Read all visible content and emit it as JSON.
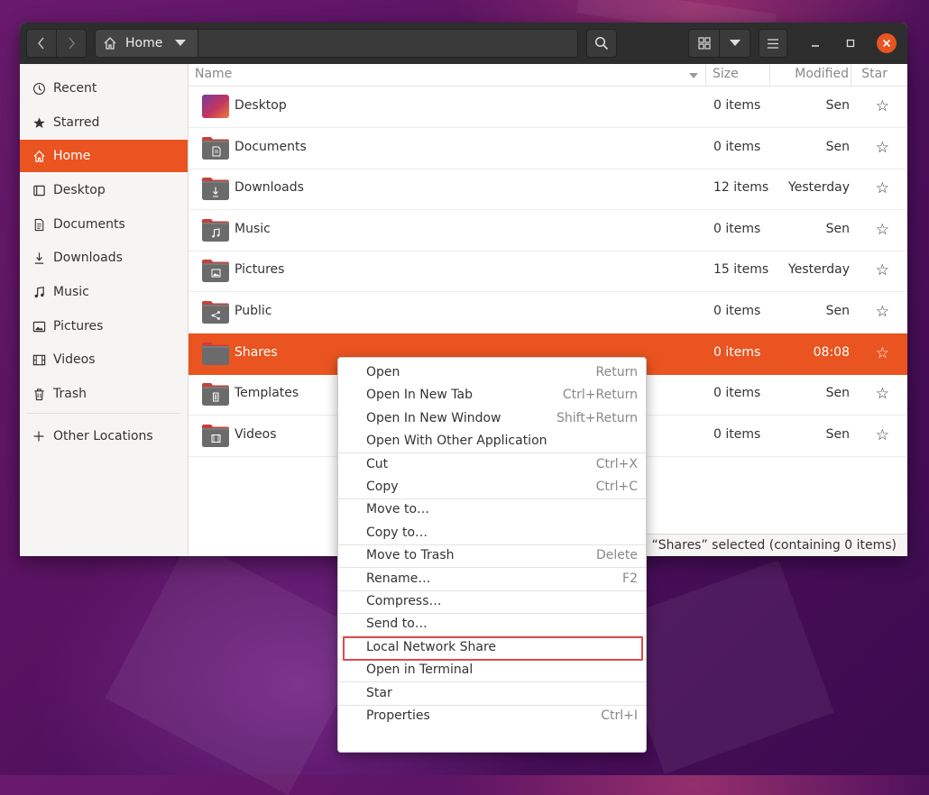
{
  "window": {
    "path": {
      "home_label": "Home"
    }
  },
  "sidebar": {
    "items": [
      {
        "label": "Recent",
        "icon": "clock-icon"
      },
      {
        "label": "Starred",
        "icon": "star-icon"
      },
      {
        "label": "Home",
        "icon": "home-icon",
        "active": true
      },
      {
        "label": "Desktop",
        "icon": "desktop-icon"
      },
      {
        "label": "Documents",
        "icon": "document-icon"
      },
      {
        "label": "Downloads",
        "icon": "download-icon"
      },
      {
        "label": "Music",
        "icon": "music-icon"
      },
      {
        "label": "Pictures",
        "icon": "picture-icon"
      },
      {
        "label": "Videos",
        "icon": "film-icon"
      },
      {
        "label": "Trash",
        "icon": "trash-icon"
      }
    ],
    "other_locations": {
      "label": "Other Locations",
      "icon": "plus-icon"
    }
  },
  "list": {
    "columns": {
      "name": "Name",
      "size": "Size",
      "modified": "Modified",
      "star": "Star"
    },
    "rows": [
      {
        "name": "Desktop",
        "size": "0 items",
        "modified": "Sen",
        "star": "☆",
        "icon": "desktop-folder-icon"
      },
      {
        "name": "Documents",
        "size": "0 items",
        "modified": "Sen",
        "star": "☆",
        "icon": "documents-folder-icon"
      },
      {
        "name": "Downloads",
        "size": "12 items",
        "modified": "Yesterday",
        "star": "☆",
        "icon": "downloads-folder-icon"
      },
      {
        "name": "Music",
        "size": "0 items",
        "modified": "Sen",
        "star": "☆",
        "icon": "music-folder-icon"
      },
      {
        "name": "Pictures",
        "size": "15 items",
        "modified": "Yesterday",
        "star": "☆",
        "icon": "pictures-folder-icon"
      },
      {
        "name": "Public",
        "size": "0 items",
        "modified": "Sen",
        "star": "☆",
        "icon": "public-folder-icon"
      },
      {
        "name": "Shares",
        "size": "0 items",
        "modified": "08:08",
        "star": "☆",
        "icon": "folder-icon",
        "selected": true
      },
      {
        "name": "Templates",
        "size": "0 items",
        "modified": "Sen",
        "star": "☆",
        "icon": "templates-folder-icon"
      },
      {
        "name": "Videos",
        "size": "0 items",
        "modified": "Sen",
        "star": "☆",
        "icon": "videos-folder-icon"
      }
    ],
    "status": "“Shares” selected  (containing 0 items)"
  },
  "context_menu": {
    "items": [
      {
        "label": "Open",
        "shortcut": "Return"
      },
      {
        "label": "Open In New Tab",
        "shortcut": "Ctrl+Return"
      },
      {
        "label": "Open In New Window",
        "shortcut": "Shift+Return"
      },
      {
        "label": "Open With Other Application",
        "shortcut": ""
      },
      {
        "label": "Cut",
        "shortcut": "Ctrl+X"
      },
      {
        "label": "Copy",
        "shortcut": "Ctrl+C"
      },
      {
        "label": "Move to…",
        "shortcut": ""
      },
      {
        "label": "Copy to…",
        "shortcut": ""
      },
      {
        "label": "Move to Trash",
        "shortcut": "Delete"
      },
      {
        "label": "Rename…",
        "shortcut": "F2"
      },
      {
        "label": "Compress…",
        "shortcut": ""
      },
      {
        "label": "Send to…",
        "shortcut": ""
      },
      {
        "label": "Local Network Share",
        "shortcut": "",
        "highlighted": true
      },
      {
        "label": "Open in Terminal",
        "shortcut": ""
      },
      {
        "label": "Star",
        "shortcut": ""
      },
      {
        "label": "Properties",
        "shortcut": "Ctrl+I"
      }
    ]
  },
  "colors": {
    "accent": "#e95420",
    "highlight_border": "#e04a4a",
    "headerbar": "#2d2d2d"
  }
}
